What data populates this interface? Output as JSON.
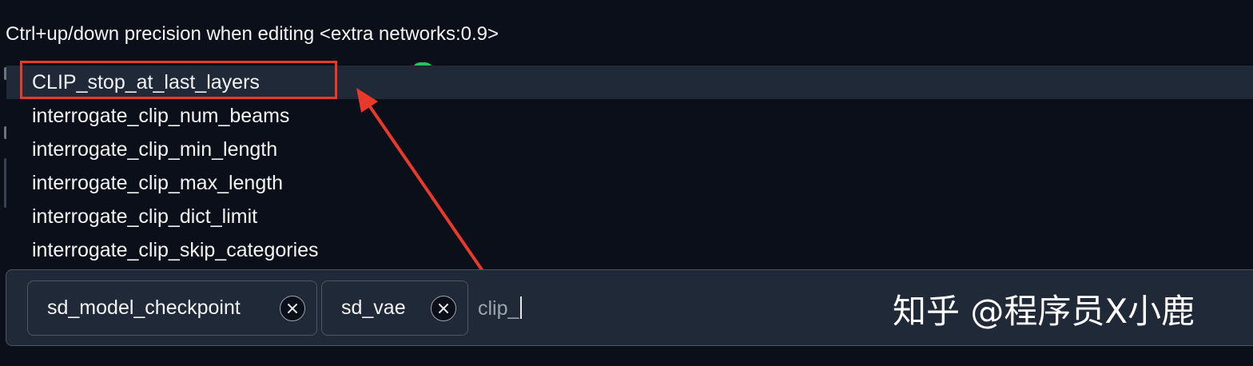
{
  "hint_text": "Ctrl+up/down precision when editing <extra networks:0.9>",
  "dropdown": {
    "items": [
      {
        "label": "CLIP_stop_at_last_layers"
      },
      {
        "label": "interrogate_clip_num_beams"
      },
      {
        "label": "interrogate_clip_min_length"
      },
      {
        "label": "interrogate_clip_max_length"
      },
      {
        "label": "interrogate_clip_dict_limit"
      },
      {
        "label": "interrogate_clip_skip_categories"
      }
    ]
  },
  "input": {
    "tags": [
      {
        "label": "sd_model_checkpoint",
        "remove_icon": "close-circle-icon"
      },
      {
        "label": "sd_vae",
        "remove_icon": "close-circle-icon"
      }
    ],
    "typed_value": "clip_"
  },
  "watermark": "知乎 @程序员X小鹿",
  "colors": {
    "background": "#0b0f19",
    "panel": "#1f2937",
    "border": "#4b5563",
    "annotation_red": "#e8392a"
  }
}
